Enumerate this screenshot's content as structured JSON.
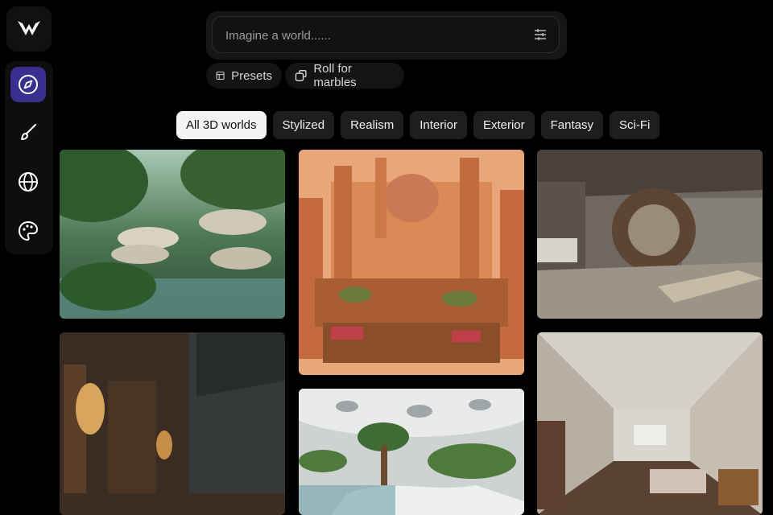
{
  "search": {
    "placeholder": "Imagine a world......"
  },
  "actions": {
    "presets_label": "Presets",
    "roll_label": "Roll for marbles"
  },
  "categories": [
    {
      "label": "All 3D worlds",
      "active": true
    },
    {
      "label": "Stylized"
    },
    {
      "label": "Realism"
    },
    {
      "label": "Interior"
    },
    {
      "label": "Exterior"
    },
    {
      "label": "Fantasy"
    },
    {
      "label": "Sci-Fi"
    }
  ],
  "sidebar": {
    "items": [
      {
        "icon": "compass-icon",
        "active": true
      },
      {
        "icon": "brush-icon"
      },
      {
        "icon": "globe-icon"
      },
      {
        "icon": "palette-icon"
      }
    ]
  },
  "colors": {
    "accent": "#3a2f8f",
    "chip_active_bg": "#f4f4f4",
    "chip_bg": "#1e1e1e"
  },
  "gallery": [
    {
      "scene": "jungle-treehouse-pods"
    },
    {
      "scene": "orange-palace-courtyard"
    },
    {
      "scene": "library-circular-bookshelf-room"
    },
    {
      "scene": "lantern-lit-library-temple"
    },
    {
      "scene": "white-organic-bonsai-garden"
    },
    {
      "scene": "abandoned-dormitory-hallway"
    }
  ]
}
